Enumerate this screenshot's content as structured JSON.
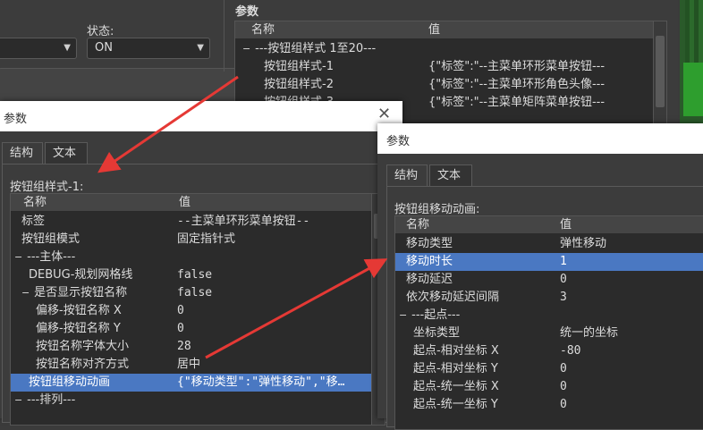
{
  "bg": {
    "status_label": "状态:",
    "status_value": "ON",
    "params_header": "参数",
    "col_name": "名称",
    "col_value": "值",
    "group": "---按钮组样式 1至20---",
    "rows": [
      {
        "name": "按钮组样式-1",
        "value": "{\"标签\":\"--主菜单环形菜单按钮---"
      },
      {
        "name": "按钮组样式-2",
        "value": "{\"标签\":\"--主菜单环形角色头像---"
      },
      {
        "name": "按钮组样式-3",
        "value": "{\"标签\":\"--主菜单矩阵菜单按钮---"
      }
    ]
  },
  "dialog1": {
    "title": "参数",
    "tabs": [
      "结构",
      "文本"
    ],
    "section_label": "按钮组样式-1:",
    "col_name": "名称",
    "col_value": "值",
    "rows": [
      {
        "name": "标签",
        "value": "--主菜单环形菜单按钮--",
        "indent": 1
      },
      {
        "name": "按钮组模式",
        "value": "固定指针式",
        "indent": 1
      },
      {
        "name": "---主体---",
        "value": "",
        "indent": 0,
        "expander": "−"
      },
      {
        "name": "DEBUG-规划网格线",
        "value": "false",
        "indent": 2
      },
      {
        "name": "是否显示按钮名称",
        "value": "false",
        "indent": 1,
        "expander": "−"
      },
      {
        "name": "偏移-按钮名称 X",
        "value": "0",
        "indent": 3
      },
      {
        "name": "偏移-按钮名称 Y",
        "value": "0",
        "indent": 3
      },
      {
        "name": "按钮名称字体大小",
        "value": "28",
        "indent": 3
      },
      {
        "name": "按钮名称对齐方式",
        "value": "居中",
        "indent": 3
      },
      {
        "name": "按钮组移动动画",
        "value": "{\"移动类型\":\"弹性移动\",\"移…",
        "indent": 2,
        "selected": true
      },
      {
        "name": "---排列---",
        "value": "",
        "indent": 0,
        "expander": "−"
      }
    ]
  },
  "dialog2": {
    "title": "参数",
    "tabs": [
      "结构",
      "文本"
    ],
    "section_label": "按钮组移动动画:",
    "col_name": "名称",
    "col_value": "值",
    "rows": [
      {
        "name": "移动类型",
        "value": "弹性移动",
        "indent": 1
      },
      {
        "name": "移动时长",
        "value": "1",
        "indent": 1,
        "selected": true
      },
      {
        "name": "移动延迟",
        "value": "0",
        "indent": 1
      },
      {
        "name": "依次移动延迟间隔",
        "value": "3",
        "indent": 1
      },
      {
        "name": "---起点---",
        "value": "",
        "indent": 0,
        "expander": "−"
      },
      {
        "name": "坐标类型",
        "value": "统一的坐标",
        "indent": 2
      },
      {
        "name": "起点-相对坐标 X",
        "value": "-80",
        "indent": 2
      },
      {
        "name": "起点-相对坐标 Y",
        "value": "0",
        "indent": 2
      },
      {
        "name": "起点-统一坐标 X",
        "value": "0",
        "indent": 2
      },
      {
        "name": "起点-统一坐标 Y",
        "value": "0",
        "indent": 2
      }
    ]
  },
  "colors": {
    "selection": "#4a78c2",
    "arrow": "#e53935",
    "green": "#2e9e2e"
  }
}
